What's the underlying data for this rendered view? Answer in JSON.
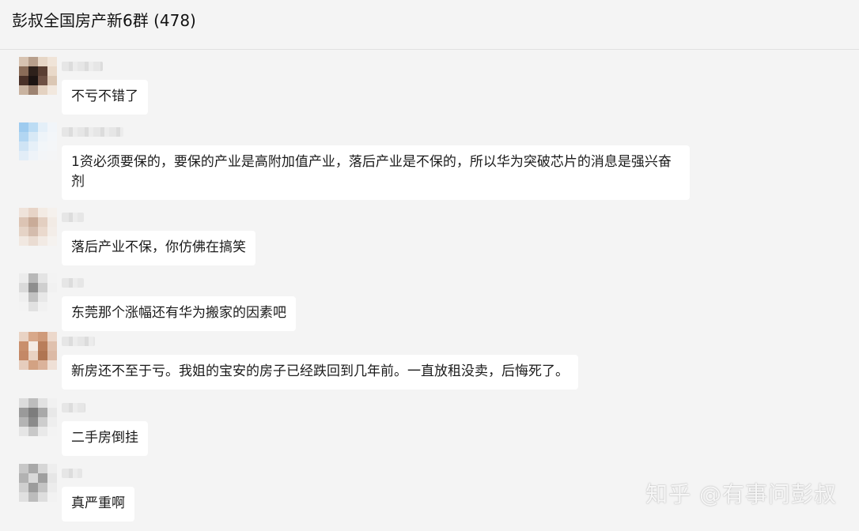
{
  "header": {
    "title": "彭叔全国房产新6群 (478)"
  },
  "messages": [
    {
      "text": "不亏不错了"
    },
    {
      "text": "1资必须要保的，要保的产业是高附加值产业，落后产业是不保的，所以华为突破芯片的消息是强兴奋剂"
    },
    {
      "text": "落后产业不保，你仿佛在搞笑"
    },
    {
      "text": "东莞那个涨幅还有华为搬家的因素吧"
    },
    {
      "text": "新房还不至于亏。我姐的宝安的房子已经跌回到几年前。一直放租没卖，后悔死了。"
    },
    {
      "text": "二手房倒挂"
    },
    {
      "text": "真严重啊"
    }
  ],
  "watermark": {
    "text": "知乎 @有事问彭叔"
  }
}
